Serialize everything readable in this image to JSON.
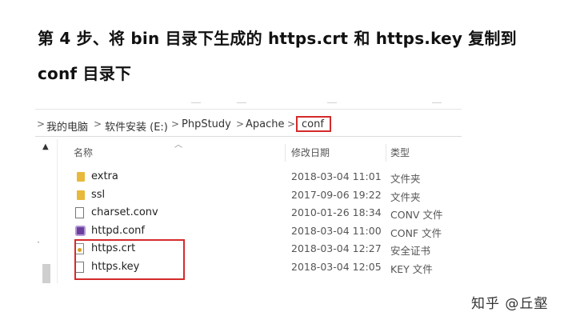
{
  "heading": {
    "line1": "第 4 步、将 bin 目录下生成的 https.crt 和 https.key 复制到",
    "line2": "conf 目录下"
  },
  "explorer": {
    "breadcrumb": [
      "我的电脑",
      "软件安装 (E:)",
      "PhpStudy",
      "Apache",
      "conf"
    ],
    "breadcrumb_separator": ">",
    "columns": {
      "name": "名称",
      "modified": "修改日期",
      "type": "类型"
    },
    "files": [
      {
        "name": "extra",
        "modified": "2018-03-04 11:01",
        "type": "文件夹",
        "icon": "folder-icon"
      },
      {
        "name": "ssl",
        "modified": "2017-09-06 19:22",
        "type": "文件夹",
        "icon": "folder-icon"
      },
      {
        "name": "charset.conv",
        "modified": "2010-01-26 18:34",
        "type": "CONV 文件",
        "icon": "document-icon"
      },
      {
        "name": "httpd.conf",
        "modified": "2018-03-04 11:00",
        "type": "CONF 文件",
        "icon": "config-file-icon"
      },
      {
        "name": "https.crt",
        "modified": "2018-03-04 12:27",
        "type": "安全证书",
        "icon": "certificate-icon"
      },
      {
        "name": "https.key",
        "modified": "2018-03-04 12:05",
        "type": "KEY 文件",
        "icon": "document-icon"
      }
    ]
  },
  "watermark": "知乎 @丘壑",
  "colors": {
    "highlight": "#d42b2b",
    "folder": "#e8b93a"
  }
}
